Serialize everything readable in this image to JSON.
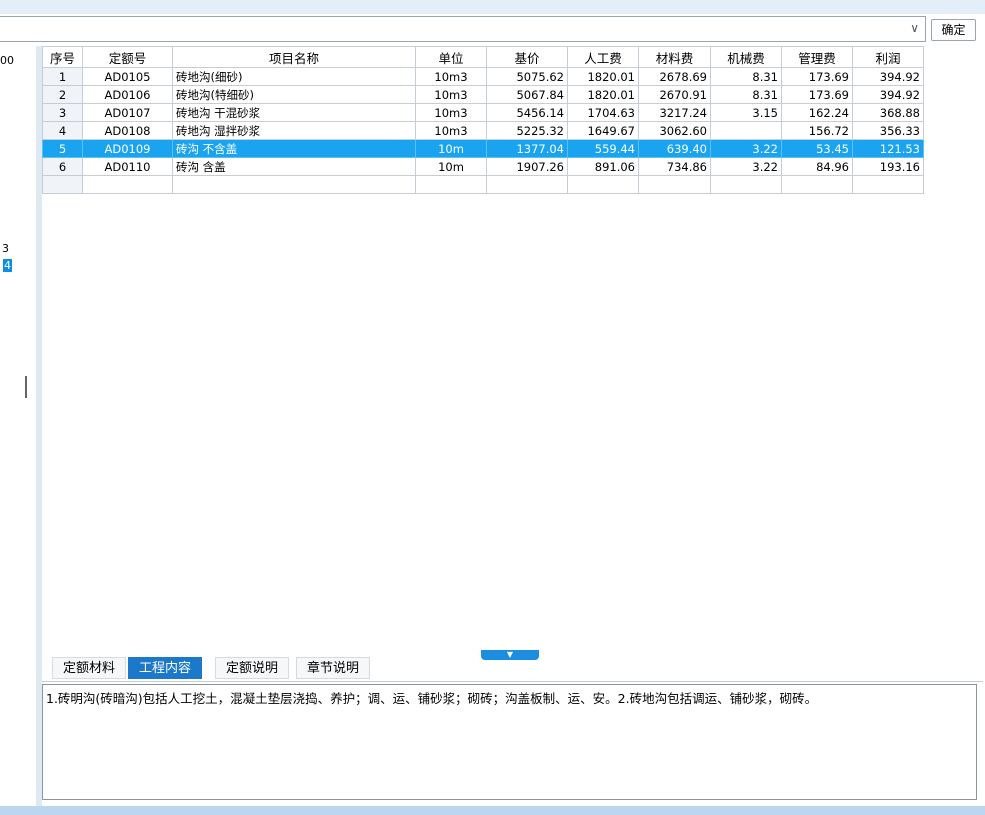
{
  "toolbar": {
    "combo_value": "",
    "combo_arrow": "∨",
    "ok_label": "确定"
  },
  "left_pane": {
    "values": [
      "00",
      "3",
      "4"
    ]
  },
  "table": {
    "headers": [
      "序号",
      "定额号",
      "项目名称",
      "单位",
      "基价",
      "人工费",
      "材料费",
      "机械费",
      "管理费",
      "利润"
    ],
    "rows": [
      {
        "seq": "1",
        "code": "AD0105",
        "name": "砖地沟(细砂)",
        "unit": "10m3",
        "base": "5075.62",
        "labor": "1820.01",
        "material": "2678.69",
        "machine": "8.31",
        "mgmt": "173.69",
        "profit": "394.92"
      },
      {
        "seq": "2",
        "code": "AD0106",
        "name": "砖地沟(特细砂)",
        "unit": "10m3",
        "base": "5067.84",
        "labor": "1820.01",
        "material": "2670.91",
        "machine": "8.31",
        "mgmt": "173.69",
        "profit": "394.92"
      },
      {
        "seq": "3",
        "code": "AD0107",
        "name": "砖地沟 干混砂浆",
        "unit": "10m3",
        "base": "5456.14",
        "labor": "1704.63",
        "material": "3217.24",
        "machine": "3.15",
        "mgmt": "162.24",
        "profit": "368.88"
      },
      {
        "seq": "4",
        "code": "AD0108",
        "name": "砖地沟 湿拌砂浆",
        "unit": "10m3",
        "base": "5225.32",
        "labor": "1649.67",
        "material": "3062.60",
        "machine": "",
        "mgmt": "156.72",
        "profit": "356.33"
      },
      {
        "seq": "5",
        "code": "AD0109",
        "name": "砖沟 不含盖",
        "unit": "10m",
        "base": "1377.04",
        "labor": "559.44",
        "material": "639.40",
        "machine": "3.22",
        "mgmt": "53.45",
        "profit": "121.53"
      },
      {
        "seq": "6",
        "code": "AD0110",
        "name": "砖沟 含盖",
        "unit": "10m",
        "base": "1907.26",
        "labor": "891.06",
        "material": "734.86",
        "machine": "3.22",
        "mgmt": "84.96",
        "profit": "193.16"
      }
    ],
    "selected_row": 5
  },
  "tabs": [
    {
      "label": "定额材料"
    },
    {
      "label": "工程内容"
    },
    {
      "label": "定额说明"
    },
    {
      "label": "章节说明"
    }
  ],
  "active_tab": 1,
  "description": "1.砖明沟(砖暗沟)包括人工挖土，混凝土垫层浇捣、养护；调、运、铺砂浆；砌砖；沟盖板制、运、安。2.砖地沟包括调运、铺砂浆，砌砖。",
  "colors": {
    "selection": "#1aa4ef",
    "active_tab": "#1c78c8"
  }
}
